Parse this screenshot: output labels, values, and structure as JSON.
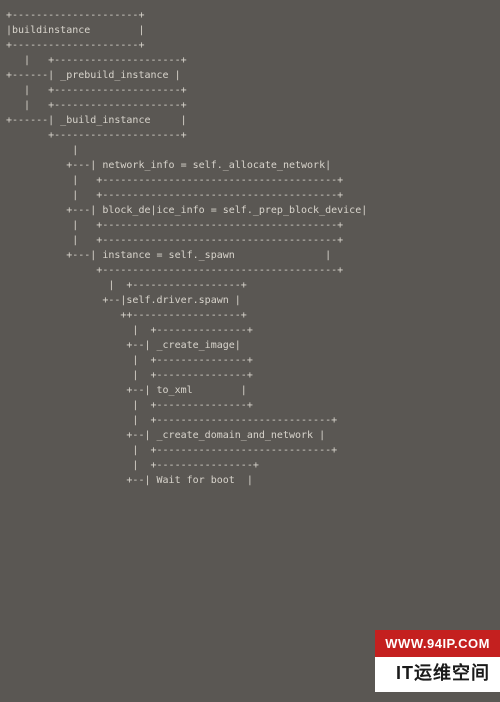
{
  "diagram": {
    "lines": [
      "+---------------------+",
      "|buildinstance        |",
      "+---------------------+",
      "   |   +---------------------+",
      "+------| _prebuild_instance |",
      "   |   +---------------------+",
      "   |   +---------------------+",
      "+------| _build_instance     |",
      "       +---------------------+",
      "           |",
      "          +---| network_info = self._allocate_network|",
      "           |   +---------------------------------------+",
      "           |   +---------------------------------------+",
      "          +---| block_de|ice_info = self._prep_block_device|",
      "           |   +---------------------------------------+",
      "           |   +---------------------------------------+",
      "          +---| instance = self._spawn               |",
      "               +---------------------------------------+",
      "                 |  +------------------+",
      "                +--|self.driver.spawn |",
      "                   ++------------------+",
      "                     |  +---------------+",
      "                    +--| _create_image|",
      "                     |  +---------------+",
      "                     |  +---------------+",
      "                    +--| to_xml        |",
      "                     |  +---------------+",
      "                     |  +-----------------------------+",
      "                    +--| _create_domain_and_network |",
      "                     |  +-----------------------------+",
      "                     |  +----------------+",
      "                    +--| Wait for boot  |"
    ]
  },
  "watermark": {
    "url": "WWW.94IP.COM",
    "brand": "IT运维空间"
  }
}
